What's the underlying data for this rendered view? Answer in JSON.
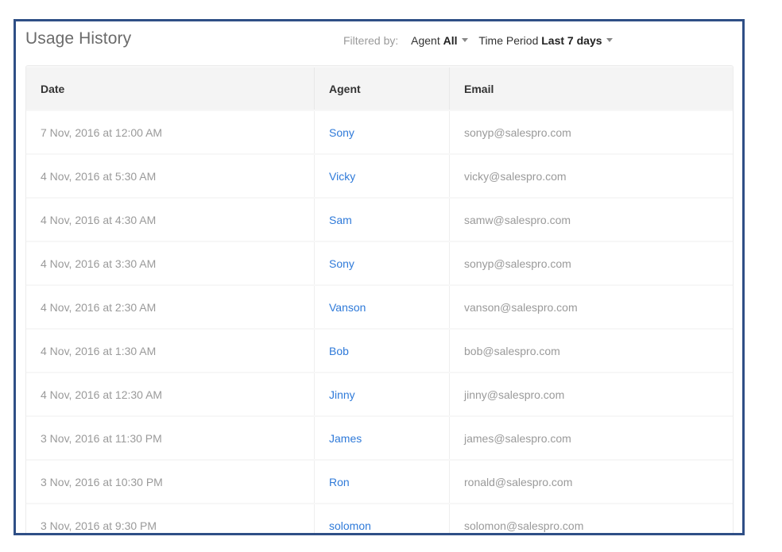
{
  "header": {
    "title": "Usage History",
    "filtered_by_label": "Filtered by:",
    "filters": [
      {
        "name": "Agent",
        "value": "All"
      },
      {
        "name": "Time Period",
        "value": "Last 7 days"
      }
    ]
  },
  "table": {
    "columns": [
      "Date",
      "Agent",
      "Email"
    ],
    "rows": [
      {
        "date": "7 Nov, 2016 at 12:00 AM",
        "agent": "Sony",
        "email": "sonyp@salespro.com"
      },
      {
        "date": "4 Nov, 2016 at 5:30 AM",
        "agent": "Vicky",
        "email": "vicky@salespro.com"
      },
      {
        "date": "4 Nov, 2016 at 4:30 AM",
        "agent": "Sam",
        "email": "samw@salespro.com"
      },
      {
        "date": "4 Nov, 2016 at 3:30 AM",
        "agent": "Sony",
        "email": "sonyp@salespro.com"
      },
      {
        "date": "4 Nov, 2016 at 2:30 AM",
        "agent": "Vanson",
        "email": "vanson@salespro.com"
      },
      {
        "date": "4 Nov, 2016 at 1:30 AM",
        "agent": "Bob",
        "email": "bob@salespro.com"
      },
      {
        "date": "4 Nov, 2016 at 12:30 AM",
        "agent": "Jinny",
        "email": "jinny@salespro.com"
      },
      {
        "date": "3 Nov, 2016 at 11:30 PM",
        "agent": "James",
        "email": "james@salespro.com"
      },
      {
        "date": "3 Nov, 2016 at 10:30 PM",
        "agent": "Ron",
        "email": "ronald@salespro.com"
      },
      {
        "date": "3 Nov, 2016 at 9:30 PM",
        "agent": "solomon",
        "email": "solomon@salespro.com"
      }
    ]
  },
  "colors": {
    "frame_border": "#2f4f86",
    "link": "#2f7ad9",
    "muted_text": "#9a9a9a"
  },
  "icons": {
    "filter_caret": "chevron-down-icon"
  }
}
